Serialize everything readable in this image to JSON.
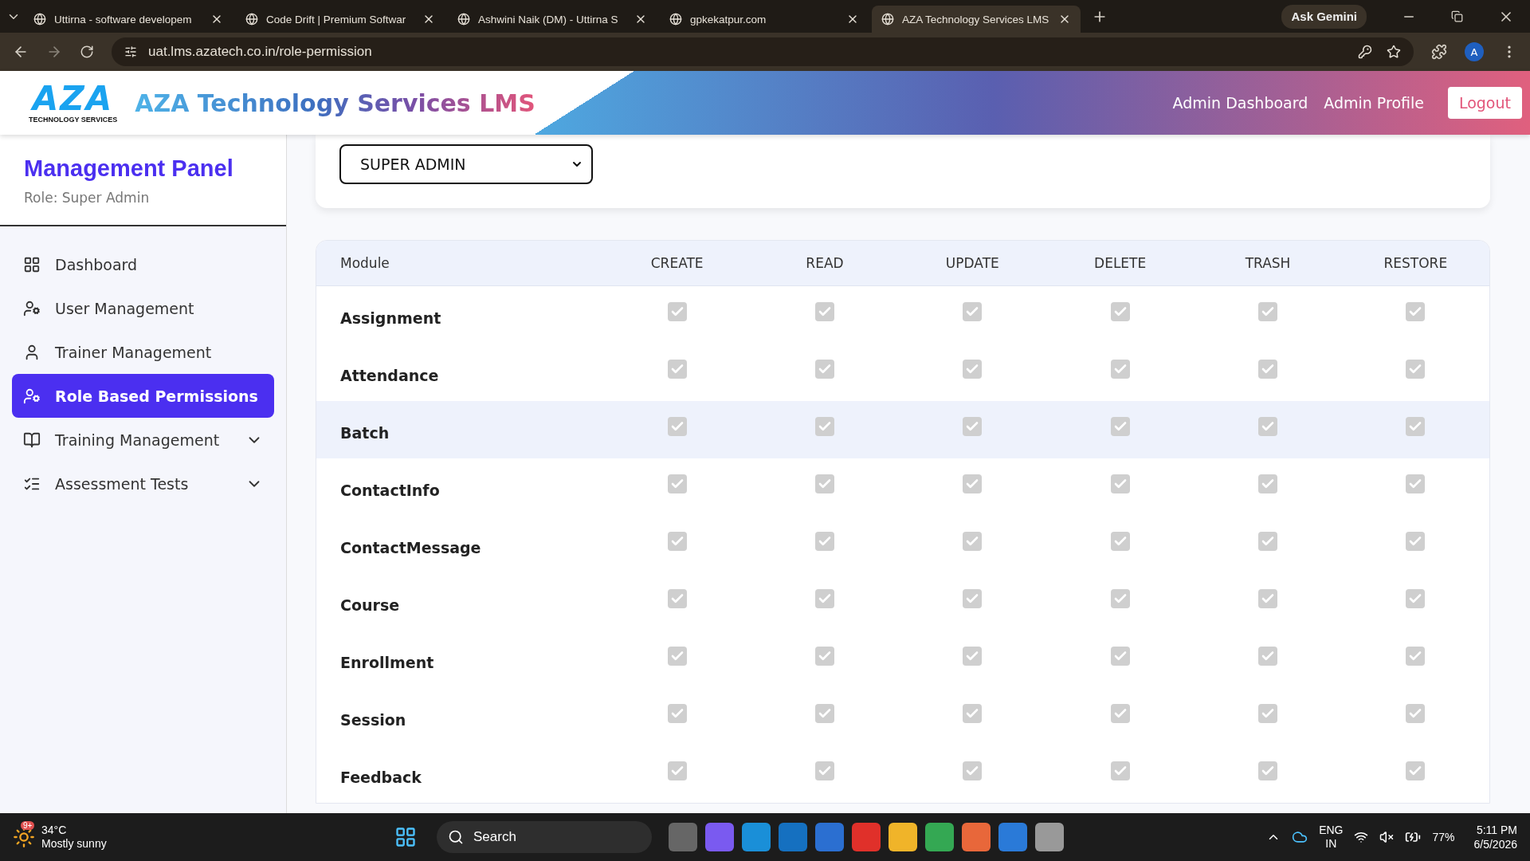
{
  "browser": {
    "tabs": [
      {
        "title": "Uttirna - software developem",
        "selected": false
      },
      {
        "title": "Code Drift | Premium Softwar",
        "selected": false
      },
      {
        "title": "Ashwini Naik (DM) - Uttirna S",
        "selected": false
      },
      {
        "title": "gpkekatpur.com",
        "selected": false
      },
      {
        "title": "AZA Technology Services LMS",
        "selected": true
      }
    ],
    "gemini": "Ask Gemini",
    "url": "uat.lms.azatech.co.in/role-permission",
    "profile": "A"
  },
  "header": {
    "logo_mark": "AZA",
    "logo_caption": "TECHNOLOGY SERVICES",
    "title": "AZA Technology Services LMS",
    "links": [
      "Admin Dashboard",
      "Admin Profile"
    ],
    "logout": "Logout"
  },
  "sidebar": {
    "title": "Management Panel",
    "role": "Role: Super Admin",
    "items": [
      {
        "label": "Dashboard",
        "selected": false,
        "expandable": false
      },
      {
        "label": "User Management",
        "selected": false,
        "expandable": false
      },
      {
        "label": "Trainer Management",
        "selected": false,
        "expandable": false
      },
      {
        "label": "Role Based Permissions",
        "selected": true,
        "expandable": false
      },
      {
        "label": "Training Management",
        "selected": false,
        "expandable": true
      },
      {
        "label": "Assessment Tests",
        "selected": false,
        "expandable": true
      }
    ]
  },
  "role_select": {
    "value": "SUPER ADMIN"
  },
  "table": {
    "columns": [
      "Module",
      "CREATE",
      "READ",
      "UPDATE",
      "DELETE",
      "TRASH",
      "RESTORE"
    ],
    "rows": [
      {
        "module": "Assignment",
        "selected": false,
        "disabled": true,
        "checked": [
          true,
          true,
          true,
          true,
          true,
          true
        ]
      },
      {
        "module": "Attendance",
        "selected": false,
        "disabled": true,
        "checked": [
          true,
          true,
          true,
          true,
          true,
          true
        ]
      },
      {
        "module": "Batch",
        "selected": true,
        "disabled": true,
        "checked": [
          true,
          true,
          true,
          true,
          true,
          true
        ]
      },
      {
        "module": "ContactInfo",
        "selected": false,
        "disabled": true,
        "checked": [
          true,
          true,
          true,
          true,
          true,
          true
        ]
      },
      {
        "module": "ContactMessage",
        "selected": false,
        "disabled": true,
        "checked": [
          true,
          true,
          true,
          true,
          true,
          true
        ]
      },
      {
        "module": "Course",
        "selected": false,
        "disabled": true,
        "checked": [
          true,
          true,
          true,
          true,
          true,
          true
        ]
      },
      {
        "module": "Enrollment",
        "selected": false,
        "disabled": true,
        "checked": [
          true,
          true,
          true,
          true,
          true,
          true
        ]
      },
      {
        "module": "Session",
        "selected": false,
        "disabled": true,
        "checked": [
          true,
          true,
          true,
          true,
          true,
          true
        ]
      },
      {
        "module": "Feedback",
        "selected": false,
        "disabled": true,
        "checked": [
          true,
          true,
          true,
          true,
          true,
          true
        ]
      }
    ]
  },
  "taskbar": {
    "weather_badge": "9+",
    "temperature": "34°C",
    "weather": "Mostly sunny",
    "search": "Search",
    "language": [
      "ENG",
      "IN"
    ],
    "battery": "77%",
    "time": "5:11 PM",
    "date": "6/5/2026"
  }
}
